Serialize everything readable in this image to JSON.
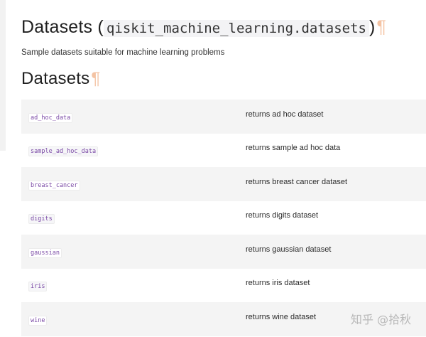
{
  "page": {
    "title_text": "Datasets (",
    "title_module": "qiskit_machine_learning.datasets",
    "title_close": ")",
    "pilcrow": "¶",
    "subtitle": "Sample datasets suitable for machine learning problems",
    "section_heading": "Datasets"
  },
  "datasets": [
    {
      "name": "ad_hoc_data",
      "description": "returns ad hoc dataset"
    },
    {
      "name": "sample_ad_hoc_data",
      "description": "returns sample ad hoc data"
    },
    {
      "name": "breast_cancer",
      "description": "returns breast cancer dataset"
    },
    {
      "name": "digits",
      "description": "returns digits dataset"
    },
    {
      "name": "gaussian",
      "description": "returns gaussian dataset"
    },
    {
      "name": "iris",
      "description": "returns iris dataset"
    },
    {
      "name": "wine",
      "description": "returns wine dataset"
    }
  ],
  "watermark": "知乎 @拾秋"
}
